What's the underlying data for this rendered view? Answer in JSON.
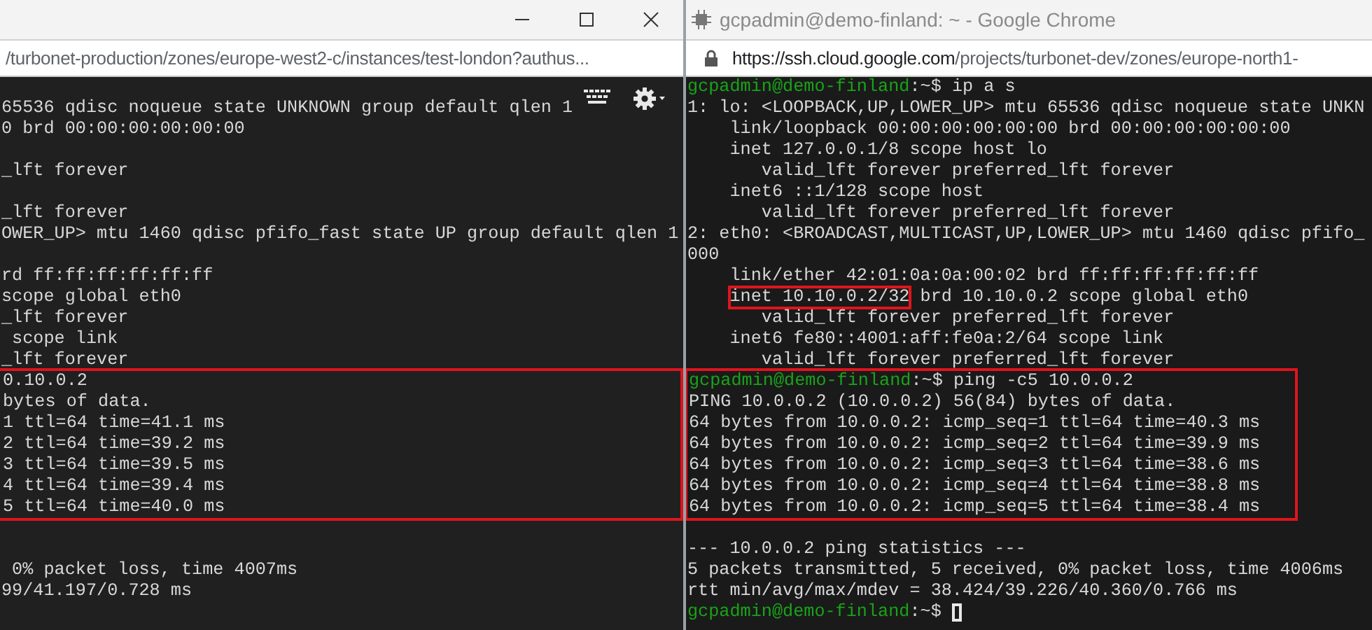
{
  "windows": [
    {
      "title_bar": {
        "controls": true
      },
      "url": {
        "path": "/turbonet-production/zones/europe-west2-c/instances/test-london?authus..."
      },
      "terminal": {
        "toolbar": true,
        "lines": [
          {
            "kind": "blank"
          },
          {
            "kind": "text",
            "segments": [
              {
                "kind": "plain",
                "text": "65536 qdisc noqueue state UNKNOWN group default qlen 1"
              }
            ]
          },
          {
            "kind": "text",
            "segments": [
              {
                "kind": "plain",
                "text": "0 brd 00:00:00:00:00:00"
              }
            ]
          },
          {
            "kind": "blank"
          },
          {
            "kind": "text",
            "segments": [
              {
                "kind": "plain",
                "text": "_lft forever"
              }
            ]
          },
          {
            "kind": "blank"
          },
          {
            "kind": "text",
            "segments": [
              {
                "kind": "plain",
                "text": "_lft forever"
              }
            ]
          },
          {
            "kind": "text",
            "segments": [
              {
                "kind": "plain",
                "text": "OWER_UP> mtu 1460 qdisc pfifo_fast state UP group default qlen 1"
              }
            ]
          },
          {
            "kind": "blank"
          },
          {
            "kind": "text",
            "segments": [
              {
                "kind": "plain",
                "text": "rd ff:ff:ff:ff:ff:ff"
              }
            ]
          },
          {
            "kind": "text",
            "segments": [
              {
                "kind": "plain",
                "text": "scope global eth0"
              }
            ]
          },
          {
            "kind": "text",
            "segments": [
              {
                "kind": "plain",
                "text": "_lft forever"
              }
            ]
          },
          {
            "kind": "text",
            "segments": [
              {
                "kind": "plain",
                "text": " scope link"
              }
            ]
          },
          {
            "kind": "text",
            "segments": [
              {
                "kind": "plain",
                "text": "_lft forever"
              }
            ]
          },
          {
            "kind": "text",
            "boxed": true,
            "segments": [
              {
                "kind": "plain",
                "text": "0.10.0.2"
              }
            ]
          },
          {
            "kind": "text",
            "boxed": true,
            "segments": [
              {
                "kind": "plain",
                "text": "bytes of data."
              }
            ]
          },
          {
            "kind": "text",
            "boxed": true,
            "segments": [
              {
                "kind": "plain",
                "text": "1 ttl=64 time=41.1 ms"
              }
            ]
          },
          {
            "kind": "text",
            "boxed": true,
            "segments": [
              {
                "kind": "plain",
                "text": "2 ttl=64 time=39.2 ms"
              }
            ]
          },
          {
            "kind": "text",
            "boxed": true,
            "segments": [
              {
                "kind": "plain",
                "text": "3 ttl=64 time=39.5 ms"
              }
            ]
          },
          {
            "kind": "text",
            "boxed": true,
            "segments": [
              {
                "kind": "plain",
                "text": "4 ttl=64 time=39.4 ms"
              }
            ]
          },
          {
            "kind": "text",
            "boxed": true,
            "segments": [
              {
                "kind": "plain",
                "text": "5 ttl=64 time=40.0 ms"
              }
            ]
          },
          {
            "kind": "blank"
          },
          {
            "kind": "blank"
          },
          {
            "kind": "text",
            "segments": [
              {
                "kind": "plain",
                "text": " 0% packet loss, time 4007ms"
              }
            ]
          },
          {
            "kind": "text",
            "segments": [
              {
                "kind": "plain",
                "text": "99/41.197/0.728 ms"
              }
            ]
          }
        ]
      }
    },
    {
      "title_bar": {
        "title": "gcpadmin@demo-finland: ~ - Google Chrome",
        "controls": false
      },
      "url": {
        "host": "https://ssh.cloud.google.com",
        "path": "/projects/turbonet-dev/zones/europe-north1-"
      },
      "terminal": {
        "toolbar": false,
        "lines": [
          {
            "kind": "text",
            "segments": [
              {
                "kind": "prompt",
                "text": "gcpadmin@demo-finland"
              },
              {
                "kind": "plain",
                "text": ":~$ ip a s"
              }
            ]
          },
          {
            "kind": "text",
            "segments": [
              {
                "kind": "plain",
                "text": "1: lo: <LOOPBACK,UP,LOWER_UP> mtu 65536 qdisc noqueue state UNKN"
              }
            ]
          },
          {
            "kind": "text",
            "segments": [
              {
                "kind": "plain",
                "text": "    link/loopback 00:00:00:00:00:00 brd 00:00:00:00:00:00"
              }
            ]
          },
          {
            "kind": "text",
            "segments": [
              {
                "kind": "plain",
                "text": "    inet 127.0.0.1/8 scope host lo"
              }
            ]
          },
          {
            "kind": "text",
            "segments": [
              {
                "kind": "plain",
                "text": "       valid_lft forever preferred_lft forever"
              }
            ]
          },
          {
            "kind": "text",
            "segments": [
              {
                "kind": "plain",
                "text": "    inet6 ::1/128 scope host"
              }
            ]
          },
          {
            "kind": "text",
            "segments": [
              {
                "kind": "plain",
                "text": "       valid_lft forever preferred_lft forever"
              }
            ]
          },
          {
            "kind": "text",
            "segments": [
              {
                "kind": "plain",
                "text": "2: eth0: <BROADCAST,MULTICAST,UP,LOWER_UP> mtu 1460 qdisc pfifo_"
              }
            ]
          },
          {
            "kind": "text",
            "segments": [
              {
                "kind": "plain",
                "text": "000"
              }
            ]
          },
          {
            "kind": "text",
            "segments": [
              {
                "kind": "plain",
                "text": "    link/ether 42:01:0a:0a:00:02 brd ff:ff:ff:ff:ff:ff"
              }
            ]
          },
          {
            "kind": "indented",
            "segments": [
              {
                "kind": "boxed",
                "text": "inet 10.10.0.2/32"
              },
              {
                "kind": "plain",
                "text": " brd 10.10.0.2 scope global eth0"
              }
            ]
          },
          {
            "kind": "text",
            "segments": [
              {
                "kind": "plain",
                "text": "       valid_lft forever preferred_lft forever"
              }
            ]
          },
          {
            "kind": "text",
            "segments": [
              {
                "kind": "plain",
                "text": "    inet6 fe80::4001:aff:fe0a:2/64 scope link"
              }
            ]
          },
          {
            "kind": "text",
            "segments": [
              {
                "kind": "plain",
                "text": "       valid_lft forever preferred_lft forever"
              }
            ]
          },
          {
            "kind": "text",
            "boxed": true,
            "segments": [
              {
                "kind": "prompt",
                "text": "gcpadmin@demo-finland"
              },
              {
                "kind": "plain",
                "text": ":~$ ping -c5 10.0.0.2"
              }
            ]
          },
          {
            "kind": "text",
            "boxed": true,
            "segments": [
              {
                "kind": "plain",
                "text": "PING 10.0.0.2 (10.0.0.2) 56(84) bytes of data."
              }
            ]
          },
          {
            "kind": "text",
            "boxed": true,
            "segments": [
              {
                "kind": "plain",
                "text": "64 bytes from 10.0.0.2: icmp_seq=1 ttl=64 time=40.3 ms"
              }
            ]
          },
          {
            "kind": "text",
            "boxed": true,
            "segments": [
              {
                "kind": "plain",
                "text": "64 bytes from 10.0.0.2: icmp_seq=2 ttl=64 time=39.9 ms"
              }
            ]
          },
          {
            "kind": "text",
            "boxed": true,
            "segments": [
              {
                "kind": "plain",
                "text": "64 bytes from 10.0.0.2: icmp_seq=3 ttl=64 time=38.6 ms"
              }
            ]
          },
          {
            "kind": "text",
            "boxed": true,
            "segments": [
              {
                "kind": "plain",
                "text": "64 bytes from 10.0.0.2: icmp_seq=4 ttl=64 time=38.8 ms"
              }
            ]
          },
          {
            "kind": "text",
            "boxed": true,
            "segments": [
              {
                "kind": "plain",
                "text": "64 bytes from 10.0.0.2: icmp_seq=5 ttl=64 time=38.4 ms"
              }
            ]
          },
          {
            "kind": "blank"
          },
          {
            "kind": "text",
            "segments": [
              {
                "kind": "plain",
                "text": "--- 10.0.0.2 ping statistics ---"
              }
            ]
          },
          {
            "kind": "text",
            "segments": [
              {
                "kind": "plain",
                "text": "5 packets transmitted, 5 received, 0% packet loss, time 4006ms"
              }
            ]
          },
          {
            "kind": "text",
            "segments": [
              {
                "kind": "plain",
                "text": "rtt min/avg/max/mdev = 38.424/39.226/40.360/0.766 ms"
              }
            ]
          },
          {
            "kind": "text",
            "cursor": true,
            "segments": [
              {
                "kind": "prompt",
                "text": "gcpadmin@demo-finland"
              },
              {
                "kind": "plain",
                "text": ":~$ "
              }
            ]
          }
        ]
      }
    }
  ]
}
